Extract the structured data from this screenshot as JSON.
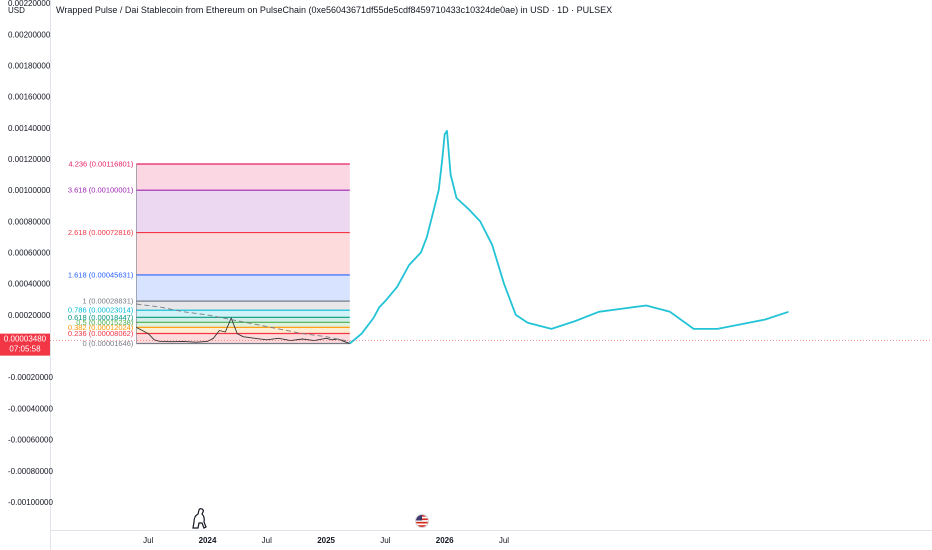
{
  "chart_data": {
    "type": "line",
    "title": "Wrapped Pulse / Dai Stablecoin from Ethereum on PulseChain (0xe56043671df55de5cdf8459710433c10324de0ae) in USD · 1D · PULSEX",
    "currency": "USD",
    "y_ticks": [
      "0.00220000",
      "0.00200000",
      "0.00180000",
      "0.00160000",
      "0.00140000",
      "0.00120000",
      "0.00100000",
      "0.00080000",
      "0.00060000",
      "0.00040000",
      "0.00020000",
      "0.00000000",
      "-0.00020000",
      "-0.00040000",
      "-0.00060000",
      "-0.00080000",
      "-0.00100000"
    ],
    "ylim": [
      -0.00118,
      0.00222
    ],
    "x_ticks": [
      {
        "label": "Jul",
        "t": 2023.5
      },
      {
        "label": "2024",
        "t": 2024.0
      },
      {
        "label": "Jul",
        "t": 2024.5
      },
      {
        "label": "2025",
        "t": 2025.0
      },
      {
        "label": "Jul",
        "t": 2025.5
      },
      {
        "label": "2026",
        "t": 2026.0
      },
      {
        "label": "Jul",
        "t": 2026.5
      }
    ],
    "xlim": [
      2022.68,
      2030.11
    ],
    "current_price": {
      "value": 3.48e-05,
      "label": "0.00003480",
      "countdown": "07:05:58",
      "color": "#f23645"
    },
    "fibonacci": {
      "x_start": 2023.4,
      "x_end": 2025.2,
      "levels": [
        {
          "label": "4.236 (0.00116801)",
          "value": 0.00116801,
          "color": "#e91e63"
        },
        {
          "label": "3.618 (0.00100001)",
          "value": 0.00100001,
          "color": "#9c27b0"
        },
        {
          "label": "2.618 (0.00072816)",
          "value": 0.00072816,
          "color": "#f23645"
        },
        {
          "label": "1.618 (0.00045631)",
          "value": 0.00045631,
          "color": "#2962ff"
        },
        {
          "label": "1 (0.00028831)",
          "value": 0.00028831,
          "color": "#787b86"
        },
        {
          "label": "0.786 (0.00023014)",
          "value": 0.00023014,
          "color": "#00bcd4"
        },
        {
          "label": "0.618 (0.00018447)",
          "value": 0.00018447,
          "color": "#089981"
        },
        {
          "label": "0.5 (0.00015238)",
          "value": 0.00015238,
          "color": "#4caf50"
        },
        {
          "label": "0.382 (0.00012024)",
          "value": 0.00012024,
          "color": "#ff9800"
        },
        {
          "label": "0.236 (0.00008062)",
          "value": 8.062e-05,
          "color": "#f23645"
        },
        {
          "label": "0 (0.00001646)",
          "value": 1.646e-05,
          "color": "#787b86"
        }
      ]
    },
    "series": [
      {
        "color": "#333333",
        "x": [
          2023.4,
          2023.45,
          2023.5,
          2023.55,
          2023.6,
          2023.7,
          2023.8,
          2023.9,
          2024.0,
          2024.05,
          2024.1,
          2024.15,
          2024.2,
          2024.25,
          2024.3,
          2024.4,
          2024.5,
          2024.6,
          2024.7,
          2024.8,
          2024.9,
          2025.0,
          2025.05,
          2025.1,
          2025.15,
          2025.2
        ],
        "y": [
          0.00012,
          0.0001,
          8e-05,
          4e-05,
          3e-05,
          2.8e-05,
          3e-05,
          2.5e-05,
          3e-05,
          5e-05,
          0.0001,
          9e-05,
          0.00018,
          8e-05,
          6e-05,
          5e-05,
          4e-05,
          5e-05,
          3.5e-05,
          4.5e-05,
          3.5e-05,
          5e-05,
          4e-05,
          4.5e-05,
          3e-05,
          1.7e-05
        ]
      },
      {
        "color": "#787b86",
        "dashed": true,
        "x": [
          2023.4,
          2023.6,
          2023.8,
          2024.0,
          2024.2,
          2024.4,
          2024.6,
          2024.8,
          2025.0,
          2025.2
        ],
        "y": [
          0.00027,
          0.00025,
          0.00022,
          0.0002,
          0.00017,
          0.00014,
          0.00011,
          8e-05,
          6e-05,
          3e-05
        ]
      },
      {
        "color": "#22c3d6",
        "x": [
          2025.2,
          2025.3,
          2025.4,
          2025.45,
          2025.5,
          2025.6,
          2025.7,
          2025.75,
          2025.8,
          2025.85,
          2025.9,
          2025.95,
          2025.98,
          2026.0,
          2026.02,
          2026.05,
          2026.1,
          2026.2,
          2026.3,
          2026.4,
          2026.5,
          2026.6,
          2026.7,
          2026.9,
          2027.1,
          2027.3,
          2027.5,
          2027.7,
          2027.9,
          2028.1,
          2028.3,
          2028.5,
          2028.7,
          2028.9
        ],
        "y": [
          1.65e-05,
          8e-05,
          0.00018,
          0.00025,
          0.00029,
          0.00038,
          0.00052,
          0.00056,
          0.0006,
          0.0007,
          0.00085,
          0.001,
          0.0012,
          0.00136,
          0.00138,
          0.0011,
          0.00095,
          0.00088,
          0.0008,
          0.00065,
          0.0004,
          0.0002,
          0.00015,
          0.00011,
          0.00016,
          0.00022,
          0.00024,
          0.00026,
          0.00022,
          0.00011,
          0.00011,
          0.00014,
          0.00017,
          0.00022
        ]
      }
    ]
  },
  "icons": {
    "logo": "dinosaur-logo-icon",
    "flag": "us-flag-icon"
  }
}
